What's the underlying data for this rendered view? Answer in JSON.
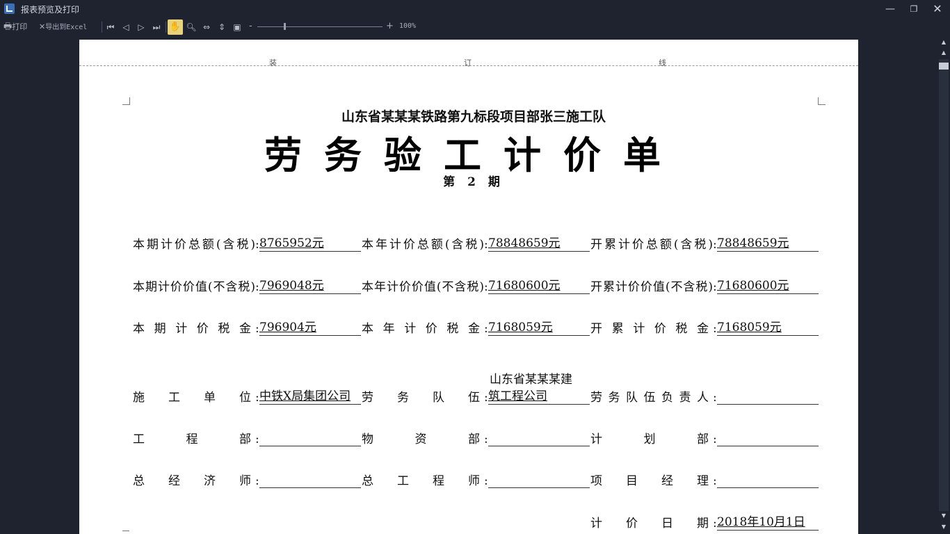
{
  "window": {
    "title": "报表预览及打印",
    "minimize_glyph": "—",
    "maximize_glyph": "❐",
    "close_glyph": "✕"
  },
  "toolbar": {
    "print_label": "打印",
    "export_label": "导出到Excel",
    "zoom_minus": "-",
    "zoom_plus": "+",
    "zoom_level": "100%",
    "zoom_fraction": 0.22
  },
  "page": {
    "binding": [
      "装",
      "订",
      "线"
    ],
    "subtitle": "山东省某某某铁路第九标段项目部张三施工队",
    "title": "劳务验工计价单",
    "period": "第 2 期",
    "rows": [
      [
        {
          "label": "本期计价总额(含税)",
          "value": "8765952元"
        },
        {
          "label": "本年计价总额(含税)",
          "value": "78848659元"
        },
        {
          "label": "开累计价总额(含税)",
          "value": "78848659元"
        }
      ],
      [
        {
          "label": "本期计价价值(不含税)",
          "value": "7969048元"
        },
        {
          "label": "本年计价价值(不含税)",
          "value": "71680600元"
        },
        {
          "label": "开累计价价值(不含税)",
          "value": "71680600元"
        }
      ],
      [
        {
          "label": "本期计价税金",
          "value": "796904元"
        },
        {
          "label": "本年计价税金",
          "value": "7168059元"
        },
        {
          "label": "开累计价税金",
          "value": "7168059元"
        }
      ],
      [
        {
          "label": "施工单位",
          "value": "中铁X局集团公司"
        },
        {
          "label": "劳务队伍",
          "value_line1": "山东省某某某建",
          "value_line2": "筑工程公司"
        },
        {
          "label": "劳务队伍负责人",
          "value": ""
        }
      ],
      [
        {
          "label": "工程部",
          "value": ""
        },
        {
          "label": "物资部",
          "value": ""
        },
        {
          "label": "计划部",
          "value": ""
        }
      ],
      [
        {
          "label": "总经济师",
          "value": ""
        },
        {
          "label": "总工程师",
          "value": ""
        },
        {
          "label": "项目经理",
          "value": ""
        }
      ],
      [
        {
          "label": "计价日期",
          "value": "2018年10月1日"
        }
      ]
    ]
  }
}
